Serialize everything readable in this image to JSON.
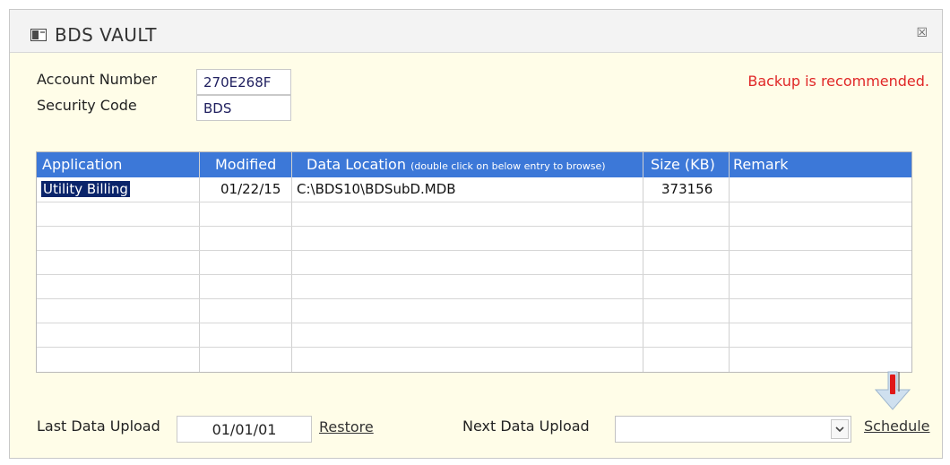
{
  "window": {
    "title": "BDS VAULT",
    "close_glyph": "☒"
  },
  "account": {
    "account_number_label": "Account Number",
    "account_number_value": "270E268F",
    "security_code_label": "Security Code",
    "security_code_value": "BDS"
  },
  "status": {
    "message": "Backup is recommended.",
    "color": "#e02727"
  },
  "table": {
    "headers": {
      "application": "Application",
      "modified": "Modified",
      "data_location": "Data Location",
      "data_location_hint": "(double click on below entry to browse)",
      "size": "Size (KB)",
      "remark": "Remark"
    },
    "rows": [
      {
        "application": "Utility Billing",
        "modified": "01/22/15",
        "data_location": "C:\\BDS10\\BDSubD.MDB",
        "size": "373156",
        "remark": ""
      }
    ],
    "header_color": "#3c78d8"
  },
  "footer": {
    "last_upload_label": "Last Data Upload",
    "last_upload_value": "01/01/01",
    "restore_link": "Restore",
    "next_upload_label": "Next Data Upload",
    "next_upload_value": "",
    "schedule_link": "Schedule"
  },
  "icons": {
    "window_icon": "form-icon",
    "dropdown_icon": "chevron-down-icon",
    "schedule_arrow": "down-arrow-icon"
  }
}
